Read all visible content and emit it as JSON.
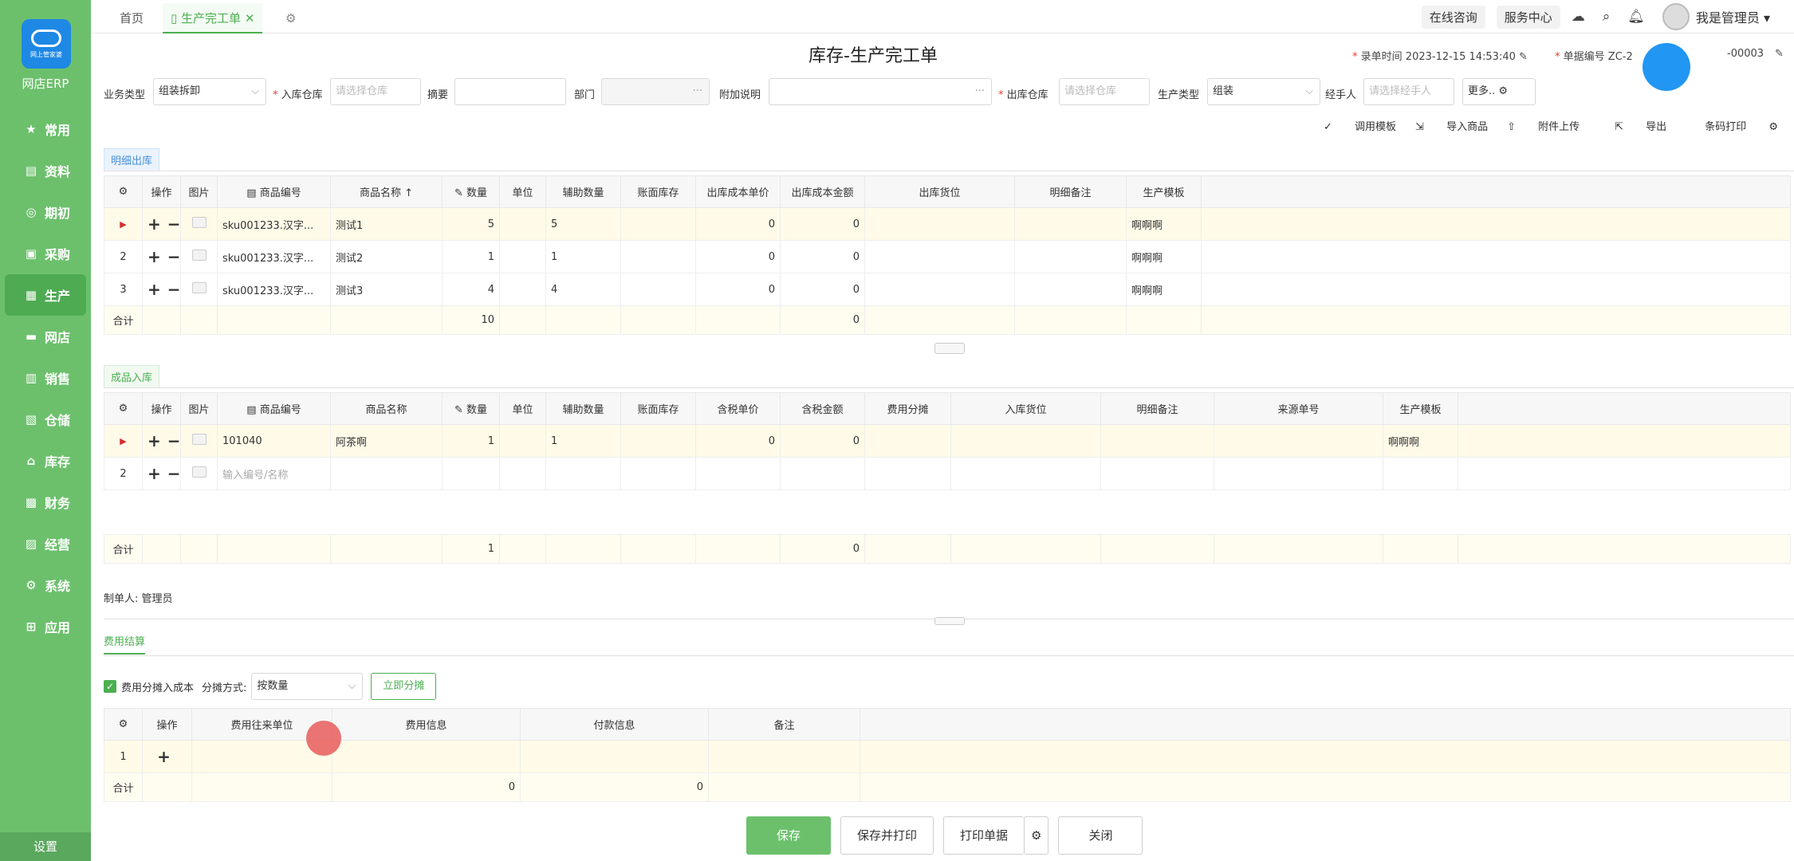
{
  "sidebar": {
    "brand": "网店ERP",
    "logo_text": "网上管家婆",
    "items": [
      {
        "label": "常用",
        "icon": "star-icon"
      },
      {
        "label": "资料",
        "icon": "document-icon"
      },
      {
        "label": "期初",
        "icon": "target-icon"
      },
      {
        "label": "采购",
        "icon": "purchase-icon"
      },
      {
        "label": "生产",
        "icon": "production-icon"
      },
      {
        "label": "网店",
        "icon": "store-icon"
      },
      {
        "label": "销售",
        "icon": "chart-icon"
      },
      {
        "label": "仓储",
        "icon": "warehouse-icon"
      },
      {
        "label": "库存",
        "icon": "inventory-icon"
      },
      {
        "label": "财务",
        "icon": "finance-icon"
      },
      {
        "label": "经营",
        "icon": "business-icon"
      },
      {
        "label": "系统",
        "icon": "gear-icon"
      },
      {
        "label": "应用",
        "icon": "plus-square-icon"
      }
    ],
    "settings": "设置"
  },
  "topbar": {
    "home_tab": "首页",
    "active_tab": "生产完工单",
    "online_consult": "在线咨询",
    "service_center": "服务中心",
    "user": "我是管理员"
  },
  "page": {
    "title": "库存-生产完工单",
    "record_time_label": "录单时间",
    "record_time": "2023-12-15 14:53:40",
    "doc_no_label": "单据编号",
    "doc_no_prefix": "ZC-2",
    "doc_no_suffix": "-00003"
  },
  "form": {
    "biz_type_label": "业务类型",
    "biz_type": "组装拆卸",
    "in_wh_label": "入库仓库",
    "in_wh_ph": "请选择仓库",
    "summary_label": "摘要",
    "dept_label": "部门",
    "extra_label": "附加说明",
    "out_wh_label": "出库仓库",
    "out_wh_ph": "请选择仓库",
    "prod_type_label": "生产类型",
    "prod_type": "组装",
    "handler_label": "经手人",
    "handler_ph": "请选择经手人",
    "more": "更多.."
  },
  "toolbar": {
    "template": "调用模板",
    "import_goods": "导入商品",
    "attach": "附件上传",
    "export": "导出",
    "barcode": "条码打印"
  },
  "out_section": {
    "tab": "明细出库",
    "headers": [
      "操作",
      "图片",
      "商品编号",
      "商品名称",
      "数量",
      "单位",
      "辅助数量",
      "账面库存",
      "出库成本单价",
      "出库成本金额",
      "出库货位",
      "明细备注",
      "生产模板"
    ],
    "rows": [
      {
        "idx": "",
        "code": "sku001233.汉字...",
        "name": "测试1",
        "qty": "5",
        "aux": "5",
        "price": "0",
        "amount": "0",
        "tpl": "啊啊啊"
      },
      {
        "idx": "2",
        "code": "sku001233.汉字...",
        "name": "测试2",
        "qty": "1",
        "aux": "1",
        "price": "0",
        "amount": "0",
        "tpl": "啊啊啊"
      },
      {
        "idx": "3",
        "code": "sku001233.汉字...",
        "name": "测试3",
        "qty": "4",
        "aux": "4",
        "price": "0",
        "amount": "0",
        "tpl": "啊啊啊"
      }
    ],
    "sum_label": "合计",
    "sum_qty": "10",
    "sum_amount": "0"
  },
  "in_section": {
    "tab": "成品入库",
    "headers": [
      "操作",
      "图片",
      "商品编号",
      "商品名称",
      "数量",
      "单位",
      "辅助数量",
      "账面库存",
      "含税单价",
      "含税金额",
      "费用分摊",
      "入库货位",
      "明细备注",
      "来源单号",
      "生产模板"
    ],
    "row1": {
      "code": "101040",
      "name": "阿茶啊",
      "qty": "1",
      "aux": "1",
      "price": "0",
      "amount": "0",
      "tpl": "啊啊啊"
    },
    "row2_idx": "2",
    "row2_ph": "输入编号/名称",
    "sum_label": "合计",
    "sum_qty": "1",
    "sum_amount": "0"
  },
  "maker": "制单人: 管理员",
  "fee": {
    "tab": "费用结算",
    "alloc_label": "费用分摊入成本",
    "method_label": "分摊方式:",
    "method": "按数量",
    "alloc_btn": "立即分摊",
    "headers": [
      "操作",
      "费用往来单位",
      "费用信息",
      "付款信息",
      "备注"
    ],
    "row_idx": "1",
    "sum_label": "合计",
    "sum_fee": "0",
    "sum_pay": "0"
  },
  "buttons": {
    "save": "保存",
    "save_print": "保存并打印",
    "print": "打印单据",
    "close": "关闭"
  }
}
